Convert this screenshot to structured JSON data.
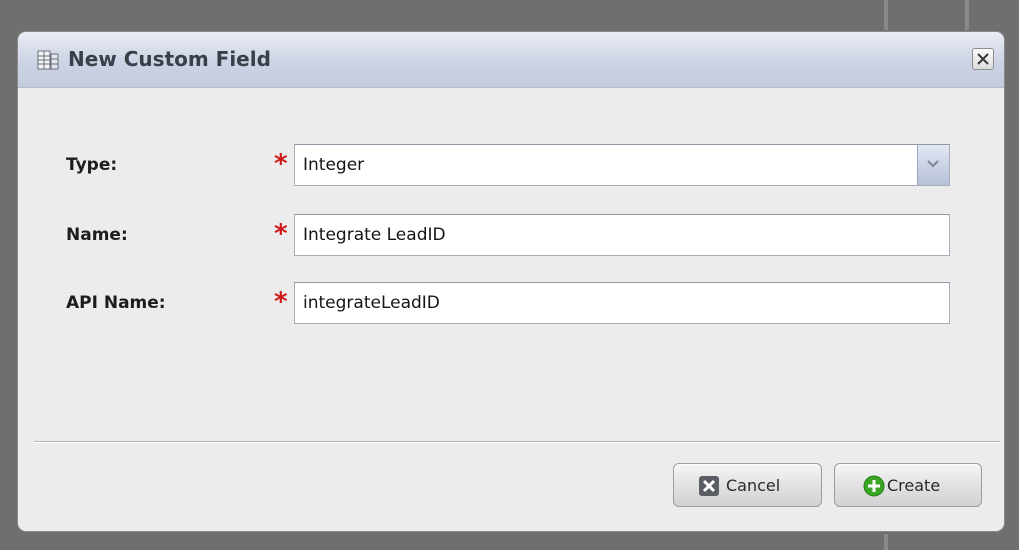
{
  "dialog": {
    "title": "New Custom Field",
    "title_icon": "database-table-icon",
    "close_icon": "close-icon"
  },
  "form": {
    "required_marker": "*",
    "type": {
      "label": "Type:",
      "value": "Integer",
      "dropdown_icon": "chevron-down-icon"
    },
    "name": {
      "label": "Name:",
      "value": "Integrate LeadID"
    },
    "api_name": {
      "label": "API Name:",
      "value": "integrateLeadID"
    }
  },
  "actions": {
    "cancel_label": "Cancel",
    "cancel_icon": "cancel-x-icon",
    "create_label": "Create",
    "create_icon": "add-plus-icon"
  },
  "colors": {
    "required": "#d01818",
    "titlebar": "#ccd3e4",
    "create_icon": "#3aa623"
  }
}
